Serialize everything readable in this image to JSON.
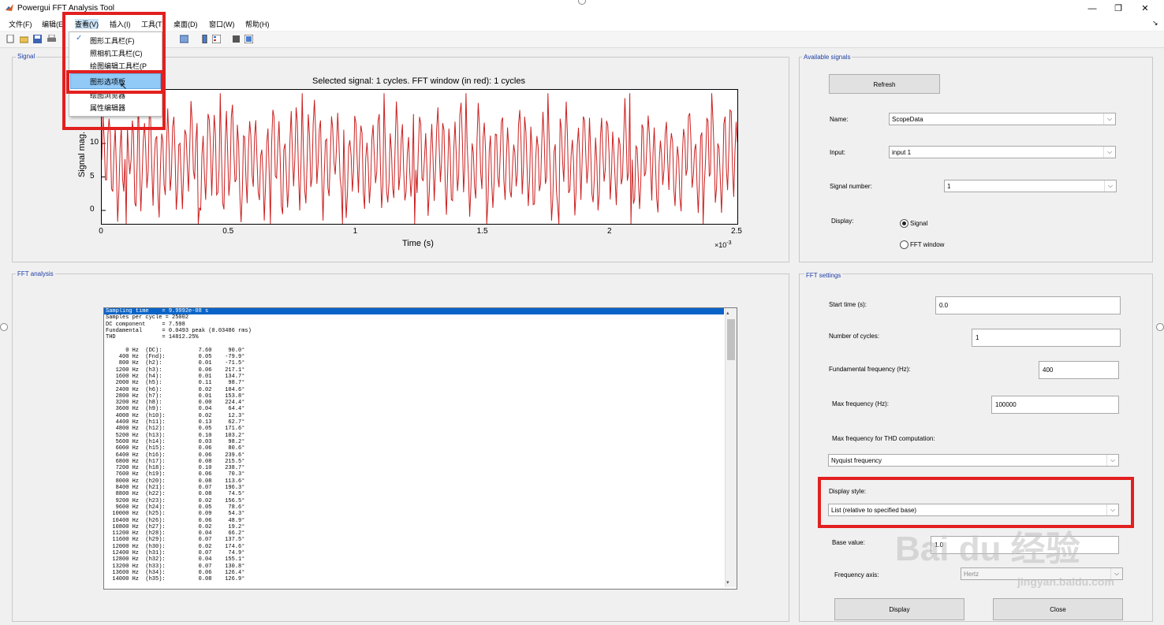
{
  "window": {
    "title": "Powergui FFT Analysis Tool",
    "minimize": "—",
    "maximize": "❐",
    "close": "✕"
  },
  "menubar": {
    "items": [
      {
        "label": "文件(F)"
      },
      {
        "label": "编辑(E"
      },
      {
        "label": "查看(V)"
      },
      {
        "label": "插入(I)"
      },
      {
        "label": "工具(T"
      },
      {
        "label": "桌面(D)"
      },
      {
        "label": "窗口(W)"
      },
      {
        "label": "帮助(H)"
      }
    ],
    "corner_arrow": "↘"
  },
  "view_menu": {
    "items": [
      {
        "label": "图形工具栏(F)",
        "checked": true
      },
      {
        "label": "照相机工具栏(C)",
        "checked": false
      },
      {
        "label": "绘图编辑工具栏(P",
        "checked": false
      },
      {
        "label": "图形选项板",
        "checked": false,
        "highlighted": true
      },
      {
        "label": "绘图浏览器",
        "checked": false
      },
      {
        "label": "属性编辑器",
        "checked": false
      }
    ],
    "check_mark": "✓"
  },
  "signal_panel": {
    "title": "Signal",
    "plot_title": "Selected signal: 1 cycles. FFT window (in red): 1 cycles",
    "ylabel": "Signal mag.",
    "xlabel": "Time (s)",
    "x_multiplier": "×10",
    "x_exponent": "-3"
  },
  "chart_data": {
    "type": "line",
    "title": "Selected signal: 1 cycles. FFT window (in red): 1 cycles",
    "xlabel": "Time (s)",
    "ylabel": "Signal mag.",
    "xlim": [
      0,
      0.0025
    ],
    "ylim": [
      -2,
      18
    ],
    "x_ticks": [
      "0",
      "0.5",
      "1",
      "1.5",
      "2",
      "2.5"
    ],
    "y_ticks": [
      "0",
      "5",
      "10",
      "15"
    ],
    "x_scale_label": "×10^-3",
    "series": [
      {
        "color": "#cc1f1f",
        "description_of_shape": "high-frequency oscillation",
        "min": -2,
        "max": 17.5
      }
    ]
  },
  "available_signals": {
    "title": "Available signals",
    "refresh_label": "Refresh",
    "name_label": "Name:",
    "name_value": "ScopeData",
    "input_label": "Input:",
    "input_value": "input 1",
    "signal_number_label": "Signal number:",
    "signal_number_value": "1",
    "display_label": "Display:",
    "display_signal": "Signal",
    "display_fft": "FFT window"
  },
  "fft_analysis": {
    "title": "FFT analysis",
    "lines": [
      "Sampling time    = 9.9992e-08 s",
      "Samples per cycle = 25002",
      "DC component     = 7.598",
      "Fundamental      = 0.0493 peak (0.03486 rms)",
      "THD              = 14812.25%",
      "",
      "      0 Hz  (DC):           7.60     90.0°",
      "    400 Hz  (Fnd):          0.05    -79.9°",
      "    800 Hz  (h2):           0.01    -71.5°",
      "   1200 Hz  (h3):           0.06    217.1°",
      "   1600 Hz  (h4):           0.01    134.7°",
      "   2000 Hz  (h5):           0.11     98.7°",
      "   2400 Hz  (h6):           0.02    104.6°",
      "   2800 Hz  (h7):           0.01    153.8°",
      "   3200 Hz  (h8):           0.00    224.4°",
      "   3600 Hz  (h9):           0.04     64.4°",
      "   4000 Hz  (h10):          0.02     12.3°",
      "   4400 Hz  (h11):          0.13     62.7°",
      "   4800 Hz  (h12):          0.05    171.6°",
      "   5200 Hz  (h13):          0.10    103.2°",
      "   5600 Hz  (h14):          0.03     98.2°",
      "   6000 Hz  (h15):          0.06     80.6°",
      "   6400 Hz  (h16):          0.06    239.6°",
      "   6800 Hz  (h17):          0.08    215.5°",
      "   7200 Hz  (h18):          0.10    238.7°",
      "   7600 Hz  (h19):          0.06     70.3°",
      "   8000 Hz  (h20):          0.08    113.6°",
      "   8400 Hz  (h21):          0.07    196.3°",
      "   8800 Hz  (h22):          0.08     74.5°",
      "   9200 Hz  (h23):          0.02    156.5°",
      "   9600 Hz  (h24):          0.05     78.6°",
      "  10000 Hz  (h25):          0.09     54.3°",
      "  10400 Hz  (h26):          0.06     48.9°",
      "  10800 Hz  (h27):          0.02     19.2°",
      "  11200 Hz  (h28):          0.04     66.2°",
      "  11600 Hz  (h29):          0.07    137.5°",
      "  12000 Hz  (h30):          0.02    174.6°",
      "  12400 Hz  (h31):          0.07     74.9°",
      "  12800 Hz  (h32):          0.04    155.1°",
      "  13200 Hz  (h33):          0.07    130.8°",
      "  13600 Hz  (h34):          0.06    126.4°",
      "  14000 Hz  (h35):          0.08    126.9°"
    ]
  },
  "fft_settings": {
    "title": "FFT settings",
    "start_time_label": "Start time (s):",
    "start_time_value": "0.0",
    "cycles_label": "Number of cycles:",
    "cycles_value": "1",
    "fund_freq_label": "Fundamental frequency (Hz):",
    "fund_freq_value": "400",
    "max_freq_label": "Max frequency (Hz):",
    "max_freq_value": "100000",
    "max_thd_label": "Max frequency for THD computation:",
    "max_thd_value": "Nyquist frequency",
    "display_style_label": "Display style:",
    "display_style_value": "List (relative to specified base)",
    "base_value_label": "Base value:",
    "base_value": "1.0",
    "freq_axis_label": "Frequency axis:",
    "freq_axis_value": "Hertz",
    "display_button": "Display",
    "close_button": "Close"
  },
  "watermark": {
    "brand": "Bai du 经验",
    "url": "jingyan.baidu.com"
  }
}
